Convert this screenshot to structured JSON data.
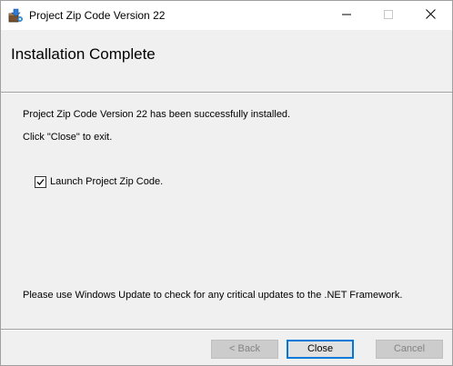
{
  "window": {
    "title": "Project Zip Code Version 22",
    "icon": "installer-package-icon",
    "controls": {
      "minimize_icon": "minimize-icon",
      "maximize_icon": "maximize-icon",
      "close_icon": "close-icon"
    }
  },
  "banner": {
    "title": "Installation Complete"
  },
  "content": {
    "success_message": "Project Zip Code Version 22 has been successfully installed.",
    "close_instruction": "Click \"Close\" to exit.",
    "launch_checkbox": {
      "label": "Launch Project Zip Code.",
      "checked": true
    },
    "update_notice": "Please use Windows Update to check for any critical updates to the .NET Framework."
  },
  "buttons": {
    "back_label": "< Back",
    "close_label": "Close",
    "cancel_label": "Cancel",
    "back_enabled": false,
    "close_enabled": true,
    "cancel_enabled": false
  },
  "colors": {
    "background": "#f0f0f0",
    "titlebar": "#ffffff",
    "focus_border": "#0078d7",
    "disabled_text": "#838383"
  }
}
